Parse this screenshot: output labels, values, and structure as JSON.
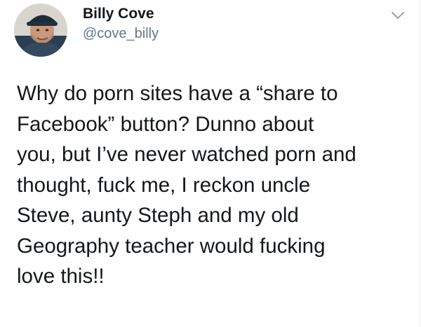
{
  "tweet": {
    "author": {
      "display_name": "Billy Cove",
      "handle": "@cove_billy",
      "avatar_icon": "profile-photo"
    },
    "menu_icon": "chevron-down-icon",
    "text_lines": [
      "Why do porn sites have a “share to",
      "Facebook” button? Dunno about",
      "you, but I’ve never watched porn and",
      "thought, fuck me, I reckon uncle",
      "Steve, aunty Steph and my old",
      "Geography teacher would fucking",
      "love this!!"
    ]
  },
  "colors": {
    "text": "#14171a",
    "secondary_text": "#657786",
    "background": "#ffffff"
  }
}
